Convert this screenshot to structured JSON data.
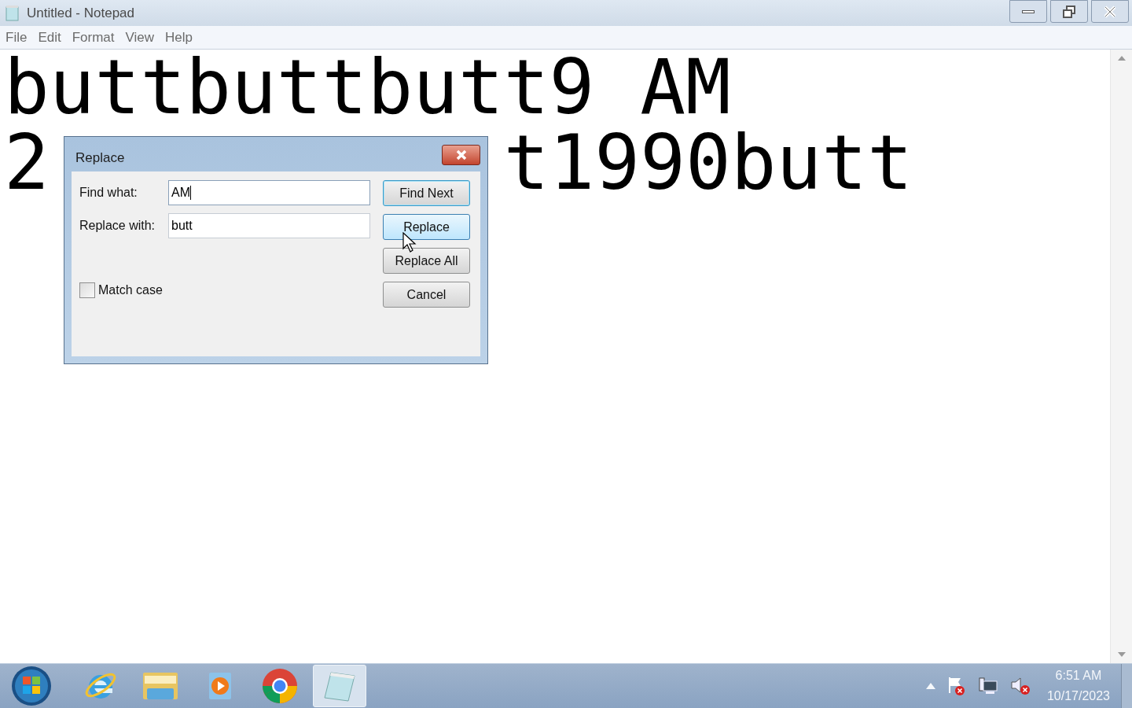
{
  "window": {
    "title": "Untitled - Notepad"
  },
  "menu": [
    "File",
    "Edit",
    "Format",
    "View",
    "Help"
  ],
  "document": {
    "line_1": "buttbuttbutt9 AM",
    "line_2_start": "2",
    "line_2_end": "t1990butt"
  },
  "dialog": {
    "title": "Replace",
    "fields": [
      {
        "label": "Find what:",
        "value": "AM",
        "focused": true
      },
      {
        "label": "Replace with:",
        "value": "butt",
        "focused": false
      }
    ],
    "buttons": [
      {
        "label": "Find Next",
        "default": true,
        "hovered": false
      },
      {
        "label": "Replace",
        "default": false,
        "hovered": true
      },
      {
        "label": "Replace All",
        "default": false,
        "hovered": false
      },
      {
        "label": "Cancel",
        "default": false,
        "hovered": false
      }
    ],
    "match_case": {
      "label": "Match case",
      "checked": false
    }
  },
  "taskbar": {
    "apps": [
      {
        "kind": "browser-e",
        "selected": false
      },
      {
        "kind": "folder",
        "selected": false
      },
      {
        "kind": "player",
        "selected": false
      },
      {
        "kind": "chrome",
        "selected": false
      },
      {
        "kind": "notepad",
        "selected": true
      }
    ],
    "time": "6:51 AM",
    "date": "10/17/2023"
  }
}
